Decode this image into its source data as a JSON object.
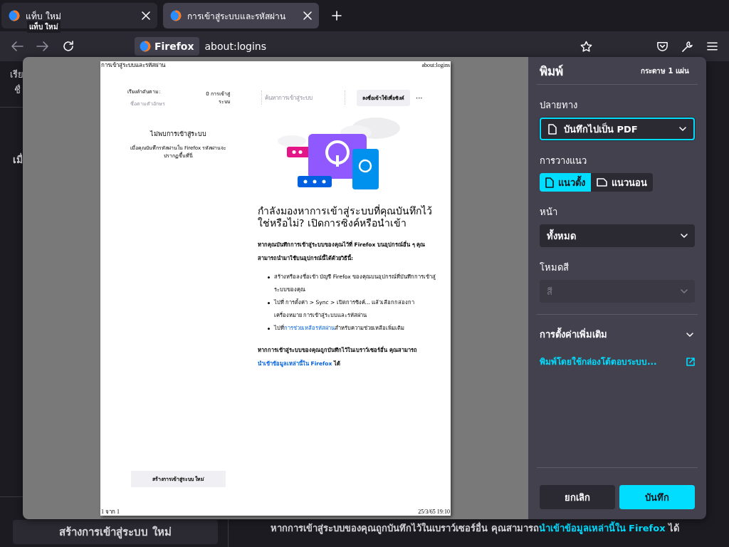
{
  "tabs": [
    {
      "title": "แท็บ ใหม่",
      "selected": false
    },
    {
      "title": "การเข้าสู่ระบบและรหัสผ่าน",
      "selected": true
    }
  ],
  "tooltip": "แท็บ ใหม่",
  "address_bar": {
    "identity": "Firefox",
    "url": "about:logins"
  },
  "background_page": {
    "sidebar_fragments": [
      "เรีย",
      "ชื่",
      "เมื่"
    ],
    "create_button": "สร้างการเข้าสู่ระบบ ใหม่",
    "import_text": {
      "text": "หากการเข้าสู่ระบบของคุณถูกบันทึกไว้ในเบราว์เซอร์อื่น คุณสามารถ",
      "link": "นำเข้าข้อมูลเหล่านี้ใน Firefox",
      "after": " ได้"
    }
  },
  "print_preview": {
    "header_left": "การเข้าสู่ระบบและรหัสผ่าน",
    "header_right": "about:logins",
    "sort_label": "เรียงลำดับตาม:",
    "sort_value": "ชื่อตามตัวอักษร",
    "count": "0 การเข้าสู่ระบบ",
    "search": {
      "placeholder": "ค้นหาการเข้าสู่ระบบ"
    },
    "sync_button": "ลงชื่อเข้าใช้เพื่อซิงค์",
    "more": "···",
    "empty_title": "ไม่พบการเข้าสู่ระบบ",
    "empty_text": "เมื่อคุณบันทึกรหัสผ่านใน Firefox รหัสผ่านจะปรากฏขึ้นที่นี่",
    "create_button": "สร้างการเข้าสู่ระบบ ใหม่",
    "heading": "กำลังมองหาการเข้าสู่ระบบที่คุณบันทึกไว้ใช่หรือไม่? เปิดการซิงค์หรือนำเข้า",
    "intro": "หากคุณบันทึกการเข้าสู่ระบบของคุณไว้ที่ Firefox บนอุปกรณ์อื่น ๆ คุณสามารถนำมาใช้บนอุปกรณ์นี้ได้ด้วยวิธีนี้:",
    "steps": [
      {
        "text": "สร้างหรือลงชื่อเข้า บัญชี Firefox ของคุณบนอุปกรณ์ที่บันทึกการเข้าสู่ระบบของคุณ"
      },
      {
        "text": "ไปที่ การตั้งค่า > Sync > เปิดการซิงค์… แล้วเลือกกล่องกาเครื่องหมาย การเข้าสู่ระบบและรหัสผ่าน"
      },
      {
        "text": "ไปที่",
        "link": "การช่วยเหลือรหัสผ่าน",
        "after": "สำหรับความช่วยเหลือเพิ่มเติม"
      }
    ],
    "outro": {
      "text": "หากการเข้าสู่ระบบของคุณถูกบันทึกไว้ในเบราว์เซอร์อื่น คุณสามารถ",
      "link": "นำเข้าข้อมูลเหล่านี้ใน Firefox",
      "after": " ได้"
    },
    "footer_left": "1 จาก 1",
    "footer_right": "25/3/65 19:10"
  },
  "print_panel": {
    "title": "พิมพ์",
    "sheets": "กระดาษ 1 แผ่น",
    "destination": {
      "label": "ปลายทาง",
      "value": "บันทึกไปเป็น PDF",
      "focused": true
    },
    "orientation": {
      "label": "การวางแนว",
      "options": [
        {
          "label": "แนวตั้ง",
          "kind": "portrait",
          "selected": true
        },
        {
          "label": "แนวนอน",
          "kind": "landscape",
          "selected": false
        }
      ]
    },
    "pages": {
      "label": "หน้า",
      "value": "ทั้งหมด"
    },
    "color_mode": {
      "label": "โหมดสี",
      "value": "สี",
      "disabled": true
    },
    "more_settings": {
      "label": "การตั้งค่าเพิ่มเติม",
      "expanded": false
    },
    "system_dialog_link": "พิมพ์โดยใช้กล่องโต้ตอบระบบ...",
    "buttons": [
      {
        "label": "ยกเลิก",
        "kind": "secondary"
      },
      {
        "label": "บันทึก",
        "kind": "primary"
      }
    ]
  }
}
